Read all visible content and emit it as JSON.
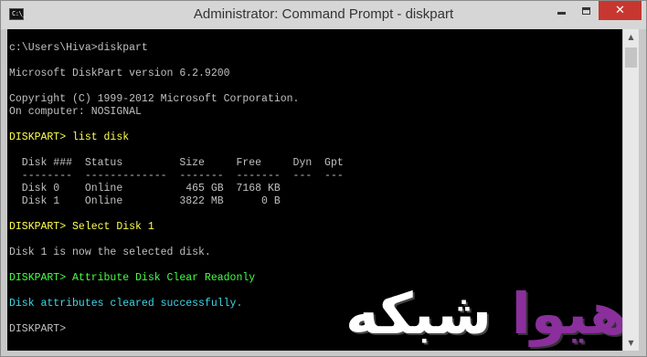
{
  "window": {
    "title": "Administrator: Command Prompt - diskpart",
    "icon_label": "C:\\_",
    "close_label": "✕"
  },
  "console": {
    "lines": [
      {
        "text": "c:\\Users\\Hiva>diskpart",
        "color": "default"
      },
      {
        "text": "",
        "color": "default"
      },
      {
        "text": "Microsoft DiskPart version 6.2.9200",
        "color": "default"
      },
      {
        "text": "",
        "color": "default"
      },
      {
        "text": "Copyright (C) 1999-2012 Microsoft Corporation.",
        "color": "default"
      },
      {
        "text": "On computer: NOSIGNAL",
        "color": "default"
      },
      {
        "text": "",
        "color": "default"
      },
      {
        "text": "DISKPART> list disk",
        "color": "yellow"
      },
      {
        "text": "",
        "color": "default"
      },
      {
        "text": "  Disk ###  Status         Size     Free     Dyn  Gpt",
        "color": "default"
      },
      {
        "text": "  --------  -------------  -------  -------  ---  ---",
        "color": "default"
      },
      {
        "text": "  Disk 0    Online          465 GB  7168 KB",
        "color": "default"
      },
      {
        "text": "  Disk 1    Online         3822 MB      0 B",
        "color": "default"
      },
      {
        "text": "",
        "color": "default"
      },
      {
        "text": "DISKPART> Select Disk 1",
        "color": "yellow"
      },
      {
        "text": "",
        "color": "default"
      },
      {
        "text": "Disk 1 is now the selected disk.",
        "color": "default"
      },
      {
        "text": "",
        "color": "default"
      },
      {
        "text": "DISKPART> Attribute Disk Clear Readonly",
        "color": "green"
      },
      {
        "text": "",
        "color": "default"
      },
      {
        "text": "Disk attributes cleared successfully.",
        "color": "cyan"
      },
      {
        "text": "",
        "color": "default"
      },
      {
        "text": "DISKPART>",
        "color": "default"
      }
    ]
  },
  "watermark": {
    "part_white": "شبکه",
    "part_purple": "هیوا"
  },
  "scrollbar": {
    "up_icon": "▲",
    "down_icon": "▼"
  },
  "colors": {
    "console_bg": "#000000",
    "default_text": "#c0c0c0",
    "yellow": "#ffff4f",
    "green": "#45ff45",
    "cyan": "#3fd7e8",
    "close_button": "#c7372f",
    "watermark_purple": "#8a2f9c"
  }
}
